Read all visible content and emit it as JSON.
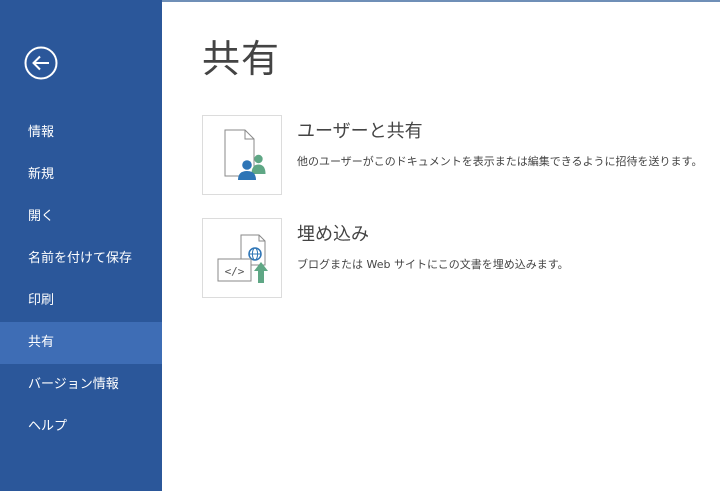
{
  "sidebar": {
    "back_icon": "back-arrow-icon",
    "items": [
      {
        "label": "情報"
      },
      {
        "label": "新規"
      },
      {
        "label": "開く"
      },
      {
        "label": "名前を付けて保存"
      },
      {
        "label": "印刷"
      },
      {
        "label": "共有",
        "active": true
      },
      {
        "label": "バージョン情報"
      },
      {
        "label": "ヘルプ"
      }
    ]
  },
  "main": {
    "title": "共有",
    "options": [
      {
        "title": "ユーザーと共有",
        "description": "他のユーザーがこのドキュメントを表示または編集できるように招待を送ります。",
        "icon": "share-with-people-icon"
      },
      {
        "title": "埋め込み",
        "description": "ブログまたは Web サイトにこの文書を埋め込みます。",
        "icon": "embed-code-icon"
      }
    ]
  },
  "colors": {
    "sidebar_bg": "#2b579a",
    "sidebar_active": "#3e6db5",
    "accent_blue": "#2e75b6",
    "accent_green": "#5fa785"
  }
}
